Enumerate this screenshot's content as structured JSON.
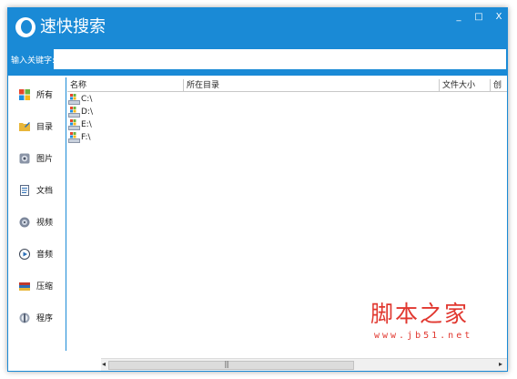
{
  "app": {
    "title": "速快搜索"
  },
  "window_buttons": {
    "minimize": "_",
    "maximize": "□",
    "close": "X"
  },
  "search": {
    "label": "输入关键字:",
    "value": "",
    "placeholder": ""
  },
  "sidebar": {
    "items": [
      {
        "label": "所有",
        "icon": "windows-icon"
      },
      {
        "label": "目录",
        "icon": "folder-icon"
      },
      {
        "label": "图片",
        "icon": "picture-icon"
      },
      {
        "label": "文档",
        "icon": "document-icon"
      },
      {
        "label": "视频",
        "icon": "video-icon"
      },
      {
        "label": "音频",
        "icon": "audio-icon"
      },
      {
        "label": "压缩",
        "icon": "archive-icon"
      },
      {
        "label": "程序",
        "icon": "program-icon"
      }
    ]
  },
  "table": {
    "columns": [
      "名称",
      "所在目录",
      "文件大小",
      "创"
    ],
    "rows": [
      {
        "name": "C:\\"
      },
      {
        "name": "D:\\"
      },
      {
        "name": "E:\\"
      },
      {
        "name": "F:\\"
      }
    ]
  },
  "scrollbar": {
    "left_arrow": "◂",
    "right_arrow": "▸",
    "grip": "|||"
  },
  "watermark": {
    "title": "脚本之家",
    "url": "www.jb51.net"
  },
  "colors": {
    "accent": "#1a8ad6",
    "watermark": "#e1372f"
  }
}
